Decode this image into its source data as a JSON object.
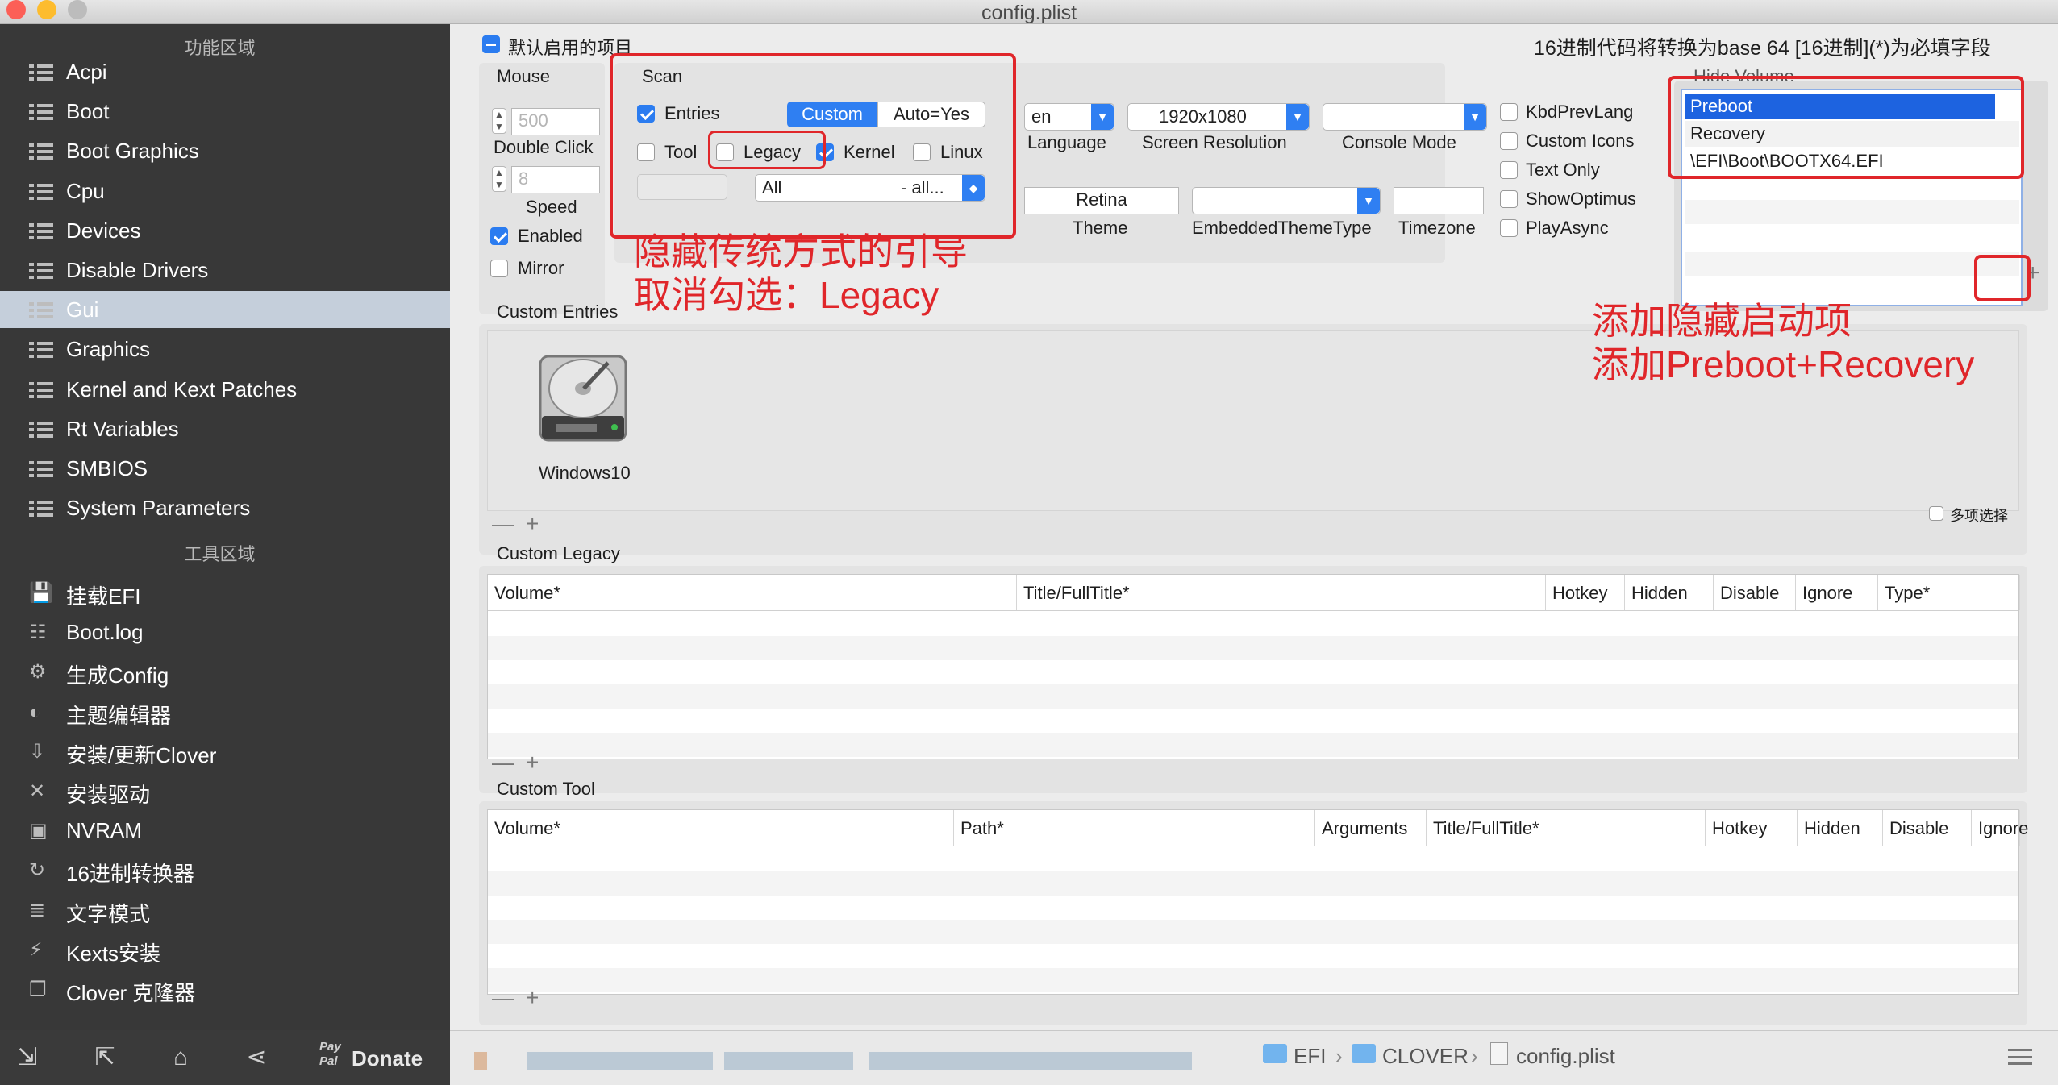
{
  "window": {
    "title": "config.plist"
  },
  "sidebar": {
    "section1_title": "功能区域",
    "items": [
      {
        "label": "Acpi"
      },
      {
        "label": "Boot"
      },
      {
        "label": "Boot Graphics"
      },
      {
        "label": "Cpu"
      },
      {
        "label": "Devices"
      },
      {
        "label": "Disable Drivers"
      },
      {
        "label": "Gui"
      },
      {
        "label": "Graphics"
      },
      {
        "label": "Kernel and Kext Patches"
      },
      {
        "label": "Rt Variables"
      },
      {
        "label": "SMBIOS"
      },
      {
        "label": "System Parameters"
      }
    ],
    "selected": "Gui",
    "section2_title": "工具区域",
    "tools": [
      {
        "label": "挂载EFI"
      },
      {
        "label": "Boot.log"
      },
      {
        "label": "生成Config"
      },
      {
        "label": "主题编辑器"
      },
      {
        "label": "安装/更新Clover"
      },
      {
        "label": "安装驱动"
      },
      {
        "label": "NVRAM"
      },
      {
        "label": "16进制转换器"
      },
      {
        "label": "文字模式"
      },
      {
        "label": "Kexts安装"
      },
      {
        "label": "Clover 克隆器"
      }
    ],
    "donate_label": "Donate",
    "paypal_label": "Pay Pal"
  },
  "header": {
    "default_enabled": "默认启用的项目",
    "hex_note": "16进制代码将转换为base 64 [16进制](*)为必填字段"
  },
  "mouse": {
    "title": "Mouse",
    "double_click_value": "500",
    "double_click_label": "Double Click",
    "speed_value": "8",
    "speed_label": "Speed",
    "enabled_label": "Enabled",
    "mirror_label": "Mirror"
  },
  "scan": {
    "title": "Scan",
    "entries_label": "Entries",
    "seg_custom": "Custom",
    "seg_auto": "Auto=Yes",
    "tool_label": "Tool",
    "legacy_label": "Legacy",
    "kernel_label": "Kernel",
    "linux_label": "Linux",
    "popup_all": "All",
    "popup_all2": "- all..."
  },
  "display": {
    "language_value": "en",
    "language_label": "Language",
    "resolution_value": "1920x1080",
    "resolution_label": "Screen Resolution",
    "console_label": "Console Mode",
    "theme_value": "Retina",
    "theme_label": "Theme",
    "embedded_label": "EmbeddedThemeType",
    "timezone_label": "Timezone"
  },
  "options": [
    "KbdPrevLang",
    "Custom Icons",
    "Text Only",
    "ShowOptimus",
    "PlayAsync"
  ],
  "hide_volume": {
    "title": "Hide Volume",
    "items": [
      "Preboot",
      "Recovery",
      "\\EFI\\Boot\\BOOTX64.EFI"
    ]
  },
  "custom_entries": {
    "title": "Custom Entries",
    "entry_label": "Windows10",
    "multi_select": "多项选择"
  },
  "custom_legacy": {
    "title": "Custom Legacy",
    "columns": [
      "Volume*",
      "Title/FullTitle*",
      "Hotkey",
      "Hidden",
      "Disable",
      "Ignore",
      "Type*"
    ]
  },
  "custom_tool": {
    "title": "Custom Tool",
    "columns": [
      "Volume*",
      "Path*",
      "Arguments",
      "Title/FullTitle*",
      "Hotkey",
      "Hidden",
      "Disable",
      "Ignore"
    ]
  },
  "annotations": {
    "legacy_line1": "隐藏传统方式的引导",
    "legacy_line2": "取消勾选：Legacy",
    "hide_line1": "添加隐藏启动项",
    "hide_line2": "添加Preboot+Recovery"
  },
  "pathbar": {
    "efi": "EFI",
    "clover": "CLOVER",
    "file": "config.plist"
  },
  "colors": {
    "accent": "#2b7cf0",
    "annotation": "#e0262a",
    "sidebar": "#383838"
  }
}
